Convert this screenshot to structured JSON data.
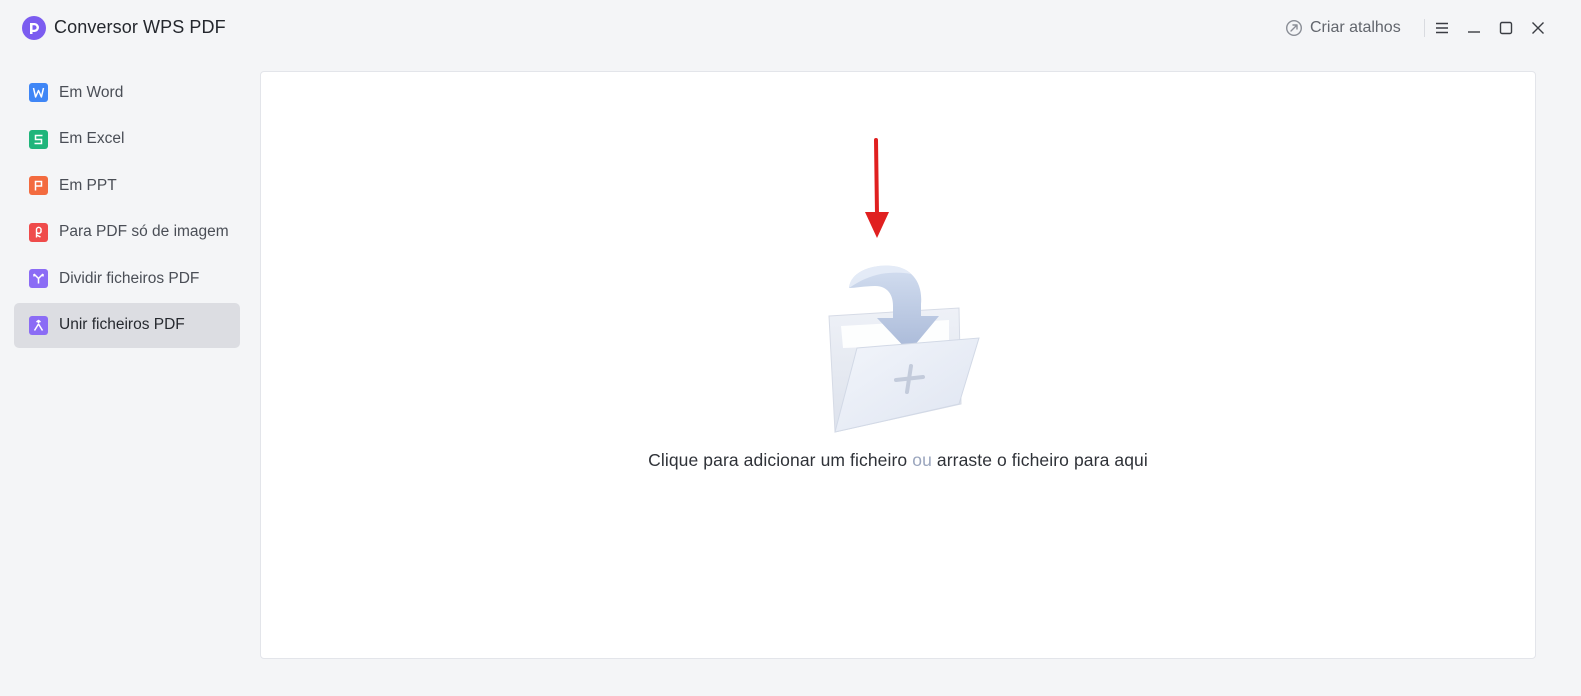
{
  "app": {
    "title": "Conversor WPS PDF",
    "logo_icon": "wps-pdf-logo-icon",
    "accent": "#7b5cf0"
  },
  "titlebar": {
    "shortcut_label": "Criar atalhos",
    "shortcut_icon": "shortcut-arrow-icon",
    "menu_icon": "menu-icon",
    "minimize_icon": "minimize-icon",
    "maximize_icon": "maximize-icon",
    "close_icon": "close-icon"
  },
  "sidebar": {
    "items": [
      {
        "label": "Em Word",
        "icon": "word-icon",
        "color": "#3f86f6",
        "active": false
      },
      {
        "label": "Em Excel",
        "icon": "excel-icon",
        "color": "#1fb57b",
        "active": false
      },
      {
        "label": "Em PPT",
        "icon": "ppt-icon",
        "color": "#f36b3f",
        "active": false
      },
      {
        "label": "Para PDF só de imagem",
        "icon": "image-pdf-icon",
        "color": "#ef4b4b",
        "active": false
      },
      {
        "label": "Dividir ficheiros PDF",
        "icon": "split-pdf-icon",
        "color": "#8b6cf5",
        "active": false
      },
      {
        "label": "Unir ficheiros PDF",
        "icon": "merge-pdf-icon",
        "color": "#8b6cf5",
        "active": true
      }
    ]
  },
  "main": {
    "drop_text_before": "Clique para adicionar um ficheiro",
    "drop_text_or": "ou",
    "drop_text_after": "arraste o ficheiro para aqui",
    "annotation_arrow_color": "#e02020",
    "folder_icon": "add-file-folder-icon"
  }
}
